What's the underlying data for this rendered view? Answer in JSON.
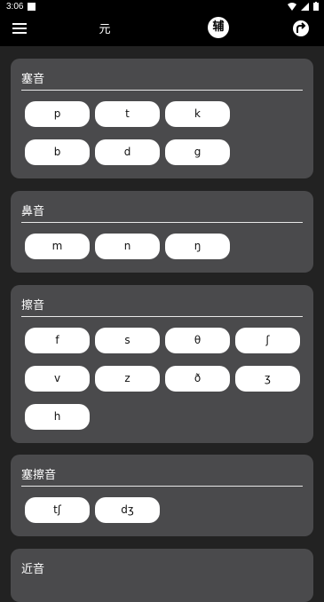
{
  "status_bar": {
    "time": "3:06"
  },
  "app_bar": {
    "tab_vowel": "元",
    "tab_consonant": "辅"
  },
  "groups": [
    {
      "title": "塞音",
      "sounds": [
        "p",
        "t",
        "k",
        "b",
        "d",
        "g"
      ]
    },
    {
      "title": "鼻音",
      "sounds": [
        "m",
        "n",
        "ŋ"
      ]
    },
    {
      "title": "擦音",
      "sounds": [
        "f",
        "s",
        "θ",
        "ʃ",
        "v",
        "z",
        "ð",
        "ʒ",
        "h"
      ]
    },
    {
      "title": "塞擦音",
      "sounds": [
        "tʃ",
        "dʒ"
      ]
    },
    {
      "title": "近音",
      "sounds": []
    }
  ],
  "colors": {
    "background": "#222222",
    "card": "#4a4a4c",
    "chip": "#ffffff",
    "bar": "#000000"
  }
}
